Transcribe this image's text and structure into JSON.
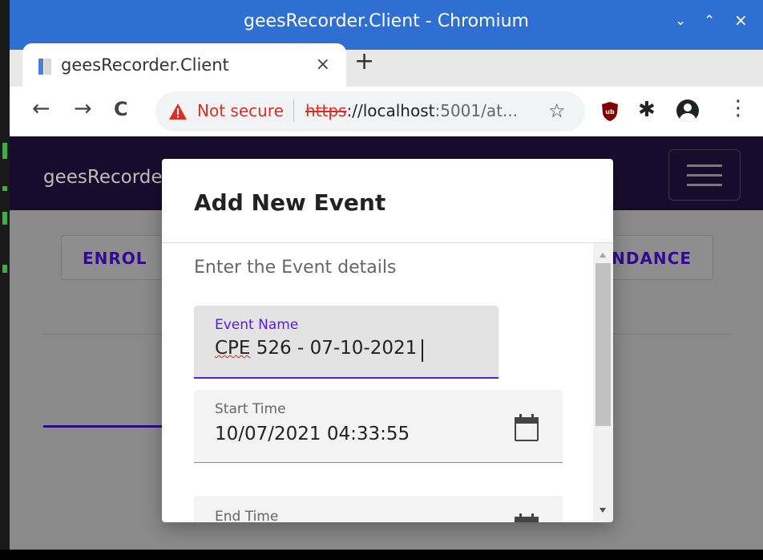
{
  "window": {
    "title": "geesRecorder.Client - Chromium"
  },
  "browser": {
    "tab_title": "geesRecorder.Client",
    "tab_close": "×",
    "new_tab": "+",
    "back": "←",
    "forward": "→",
    "reload": "C",
    "security_text": "Not secure",
    "url_scheme": "https",
    "url_host": "://localhost",
    "url_rest": ":5001/at...",
    "menu": "⋮"
  },
  "page": {
    "brand": "geesRecorder",
    "buttons": {
      "enrol": "ENROL",
      "attendance": "ATTENDANCE"
    }
  },
  "modal": {
    "title": "Add New Event",
    "subtitle": "Enter the Event details",
    "fields": {
      "event_name": {
        "label": "Event Name",
        "value_prefix": "CPE",
        "value_rest": " 526 - 07-10-2021"
      },
      "start_time": {
        "label": "Start Time",
        "value": "10/07/2021 04:33:55"
      },
      "end_time": {
        "label": "End Time"
      }
    }
  },
  "colors": {
    "titlebar": "#2f6fd1",
    "navbar": "#180c2c",
    "accent": "#5a1be0",
    "insecure": "#d93025"
  },
  "icons": [
    "star-icon",
    "ublock-extension-icon",
    "puzzle-extension-icon",
    "profile-icon",
    "calendar-icon",
    "warning-icon",
    "menu-icon"
  ]
}
